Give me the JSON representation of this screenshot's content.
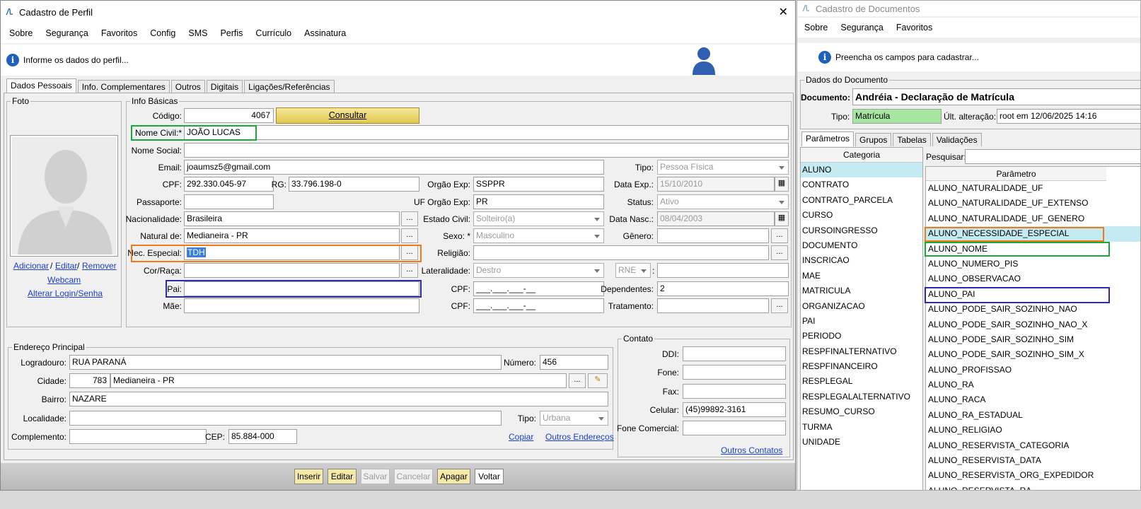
{
  "left_window": {
    "title": "Cadastro de Perfil",
    "close_glyph": "✕",
    "menu": [
      "Sobre",
      "Segurança",
      "Favoritos",
      "Config",
      "SMS",
      "Perfis",
      "Currículo",
      "Assinatura"
    ],
    "info_message": "Informe os dados do perfil...",
    "tabs": [
      "Dados Pessoais",
      "Info. Complementares",
      "Outros",
      "Digitais",
      "Ligações/Referências"
    ],
    "foto": {
      "legend": "Foto",
      "links": {
        "adicionar": "Adicionar",
        "sep1": "/",
        "editar": "Editar",
        "sep2": "/",
        "remover": "Remover",
        "webcam": "Webcam",
        "alterar": "Alterar Login/Senha"
      }
    },
    "info_basicas": {
      "legend": "Info Básicas",
      "codigo_label": "Código:",
      "codigo": "4067",
      "consultar": "Consultar",
      "nome_civil_label": "Nome Civil:*",
      "nome_civil": "JOÃO LUCAS",
      "nome_social_label": "Nome Social:",
      "nome_social": "",
      "email_label": "Email:",
      "email": "joaumsz5@gmail.com",
      "tipo_label": "Tipo:",
      "tipo": "Pessoa Física",
      "cpf_label": "CPF:",
      "cpf": "292.330.045-97",
      "rg_label": "RG:",
      "rg": "33.796.198-0",
      "orgao_label": "Orgão Exp:",
      "orgao": "SSPPR",
      "data_exp_label": "Data Exp.:",
      "data_exp": "15/10/2010",
      "passaporte_label": "Passaporte:",
      "passaporte": "",
      "uf_orgao_label": "UF Orgão Exp:",
      "uf_orgao": "PR",
      "status_label": "Status:",
      "status": "Ativo",
      "nacionalidade_label": "Nacionalidade:",
      "nacionalidade": "Brasileira",
      "estado_civil_label": "Estado Civil:",
      "estado_civil": "Solteiro(a)",
      "data_nasc_label": "Data Nasc.:",
      "data_nasc": "08/04/2003",
      "natural_label": "Natural de:",
      "natural": "Medianeira - PR",
      "sexo_label": "Sexo: *",
      "sexo": "Masculino",
      "genero_label": "Gênero:",
      "genero": "",
      "nec_especial_label": "Nec. Especial:",
      "nec_especial": "TDH",
      "religiao_label": "Religião:",
      "religiao": "",
      "cor_raca_label": "Cor/Raça:",
      "cor_raca": "",
      "lateralidade_label": "Lateralidade:",
      "lateralidade": "Destro",
      "rne": "RNE",
      "rne_colon": ":",
      "pai_label": "Pai:",
      "pai": "",
      "cpf_pai_label": "CPF:",
      "cpf_pai": "___.___.___-__",
      "dependentes_label": "Dependentes:",
      "dependentes": "2",
      "mae_label": "Mãe:",
      "mae": "",
      "cpf_mae_label": "CPF:",
      "cpf_mae": "___.___.___-__",
      "tratamento_label": "Tratamento:",
      "tratamento": "",
      "ellipsis": "..."
    },
    "endereco": {
      "legend": "Endereço Principal",
      "logradouro_label": "Logradouro:",
      "logradouro": "RUA PARANÁ",
      "numero_label": "Número:",
      "numero": "456",
      "cidade_label": "Cidade:",
      "cidade_code": "783",
      "cidade": "Medianeira - PR",
      "bairro_label": "Bairro:",
      "bairro": "NAZARE",
      "localidade_label": "Localidade:",
      "localidade": "",
      "tipo_label": "Tipo:",
      "tipo": "Urbana",
      "complemento_label": "Complemento:",
      "complemento": "",
      "cep_label": "CEP:",
      "cep": "85.884-000",
      "copiar": "Copiar",
      "outros_enderecos": "Outros Endereços"
    },
    "contato": {
      "legend": "Contato",
      "ddi_label": "DDI:",
      "ddi": "",
      "fone_label": "Fone:",
      "fone": "",
      "fax_label": "Fax:",
      "fax": "",
      "celular_label": "Celular:",
      "celular": "(45)99892-3161",
      "fone_comercial_label": "Fone Comercial:",
      "fone_comercial": "",
      "outros_contatos": "Outros Contatos"
    },
    "buttons": {
      "inserir": "Inserir",
      "editar": "Editar",
      "salvar": "Salvar",
      "cancelar": "Cancelar",
      "apagar": "Apagar",
      "voltar": "Voltar"
    }
  },
  "right_window": {
    "title": "Cadastro de Documentos",
    "menu": [
      "Sobre",
      "Segurança",
      "Favoritos"
    ],
    "info_message": "Preencha os campos para cadastrar...",
    "dados_legend": "Dados do Documento",
    "documento_label": "Documento:",
    "documento": "Andréia - Declaração de Matrícula",
    "tipo_label": "Tipo:",
    "tipo": "Matrícula",
    "ult_alt_label": "Últ. alteração:",
    "ult_alt": "root em 12/06/2025 14:16",
    "tabs": [
      "Parâmetros",
      "Grupos",
      "Tabelas",
      "Validações"
    ],
    "categoria_header": "Categoria",
    "categorias": [
      "ALUNO",
      "CONTRATO",
      "CONTRATO_PARCELA",
      "CURSO",
      "CURSOINGRESSO",
      "DOCUMENTO",
      "INSCRICAO",
      "MAE",
      "MATRICULA",
      "ORGANIZACAO",
      "PAI",
      "PERIODO",
      "RESPFINALTERNATIVO",
      "RESPFINANCEIRO",
      "RESPLEGAL",
      "RESPLEGALALTERNATIVO",
      "RESUMO_CURSO",
      "TURMA",
      "UNIDADE"
    ],
    "pesquisar_label": "Pesquisar:",
    "parametro_header": "Parâmetro",
    "parametros": [
      "ALUNO_NATURALIDADE_UF",
      "ALUNO_NATURALIDADE_UF_EXTENSO",
      "ALUNO_NATURALIDADE_UF_GENERO",
      "ALUNO_NECESSIDADE_ESPECIAL",
      "ALUNO_NOME",
      "ALUNO_NUMERO_PIS",
      "ALUNO_OBSERVACAO",
      "ALUNO_PAI",
      "ALUNO_PODE_SAIR_SOZINHO_NAO",
      "ALUNO_PODE_SAIR_SOZINHO_NAO_X",
      "ALUNO_PODE_SAIR_SOZINHO_SIM",
      "ALUNO_PODE_SAIR_SOZINHO_SIM_X",
      "ALUNO_PROFISSAO",
      "ALUNO_RA",
      "ALUNO_RACA",
      "ALUNO_RA_ESTADUAL",
      "ALUNO_RELIGIAO",
      "ALUNO_RESERVISTA_CATEGORIA",
      "ALUNO_RESERVISTA_DATA",
      "ALUNO_RESERVISTA_ORG_EXPEDIDOR",
      "ALUNO_RESERVISTA_RA"
    ]
  }
}
